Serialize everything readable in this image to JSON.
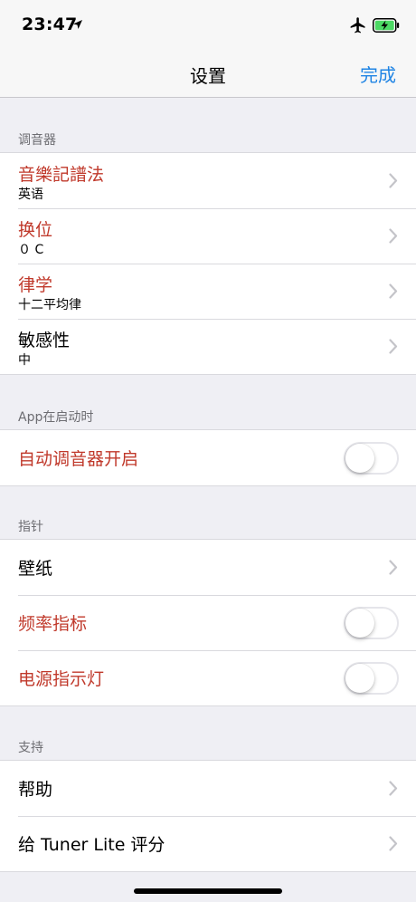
{
  "status_bar": {
    "time": "23:47"
  },
  "nav": {
    "title": "设置",
    "done_label": "完成"
  },
  "sections": {
    "tuner": {
      "header": "调音器",
      "notation": {
        "title": "音樂記譜法",
        "value": "英语"
      },
      "transpose": {
        "title": "换位",
        "value": "０ C"
      },
      "temperament": {
        "title": "律学",
        "value": "十二平均律"
      },
      "sensitivity": {
        "title": "敏感性",
        "value": "中"
      }
    },
    "startup": {
      "header": "App在启动时",
      "auto_tuner": {
        "title": "自动调音器开启",
        "on": false
      }
    },
    "needle": {
      "header": "指针",
      "wallpaper": {
        "title": "壁纸"
      },
      "freq_indicator": {
        "title": "频率指标",
        "on": false
      },
      "power_light": {
        "title": "电源指示灯",
        "on": false
      }
    },
    "support": {
      "header": "支持",
      "help": {
        "title": "帮助"
      },
      "rate": {
        "title": "给 Tuner Lite 评分"
      }
    }
  },
  "colors": {
    "accent": "#1f84e4",
    "red_label": "#c0392b",
    "background": "#efeff4"
  },
  "icons": [
    "location-arrow-icon",
    "airplane-icon",
    "battery-charging-icon",
    "chevron-right-icon"
  ]
}
